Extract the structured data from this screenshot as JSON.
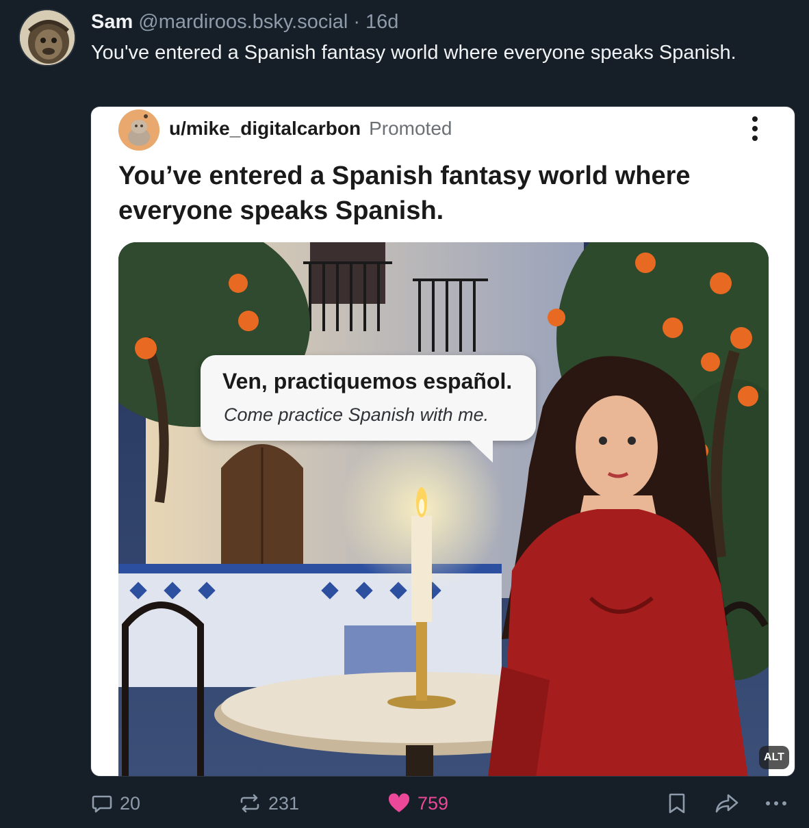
{
  "post": {
    "author_name": "Sam",
    "author_handle": "@mardiroos.bsky.social",
    "separator": "·",
    "age": "16d",
    "text": "You've entered a Spanish fantasy world where everyone speaks Spanish."
  },
  "embed": {
    "username": "u/mike_digitalcarbon",
    "promoted_label": "Promoted",
    "title": "You’ve entered a Spanish fantasy world where everyone speaks Spanish.",
    "speech_spanish": "Ven, practiquemos español.",
    "speech_english": "Come practice Spanish with me.",
    "alt_badge": "ALT"
  },
  "actions": {
    "reply_count": "20",
    "repost_count": "231",
    "like_count": "759"
  },
  "colors": {
    "background": "#161e27",
    "muted_text": "#8d9bab",
    "like_pink": "#ec4899"
  },
  "icons": [
    "reply-icon",
    "repost-icon",
    "heart-icon",
    "bookmark-icon",
    "share-icon",
    "more-icon",
    "kebab-menu-icon"
  ]
}
